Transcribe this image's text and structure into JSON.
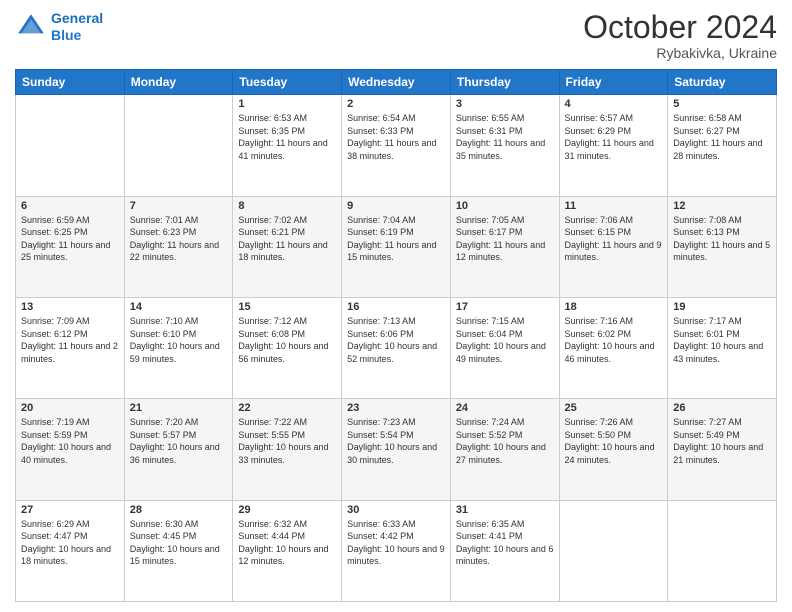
{
  "header": {
    "logo_line1": "General",
    "logo_line2": "Blue",
    "month": "October 2024",
    "location": "Rybakivka, Ukraine"
  },
  "weekdays": [
    "Sunday",
    "Monday",
    "Tuesday",
    "Wednesday",
    "Thursday",
    "Friday",
    "Saturday"
  ],
  "weeks": [
    [
      {
        "day": "",
        "content": ""
      },
      {
        "day": "",
        "content": ""
      },
      {
        "day": "1",
        "content": "Sunrise: 6:53 AM\nSunset: 6:35 PM\nDaylight: 11 hours and 41 minutes."
      },
      {
        "day": "2",
        "content": "Sunrise: 6:54 AM\nSunset: 6:33 PM\nDaylight: 11 hours and 38 minutes."
      },
      {
        "day": "3",
        "content": "Sunrise: 6:55 AM\nSunset: 6:31 PM\nDaylight: 11 hours and 35 minutes."
      },
      {
        "day": "4",
        "content": "Sunrise: 6:57 AM\nSunset: 6:29 PM\nDaylight: 11 hours and 31 minutes."
      },
      {
        "day": "5",
        "content": "Sunrise: 6:58 AM\nSunset: 6:27 PM\nDaylight: 11 hours and 28 minutes."
      }
    ],
    [
      {
        "day": "6",
        "content": "Sunrise: 6:59 AM\nSunset: 6:25 PM\nDaylight: 11 hours and 25 minutes."
      },
      {
        "day": "7",
        "content": "Sunrise: 7:01 AM\nSunset: 6:23 PM\nDaylight: 11 hours and 22 minutes."
      },
      {
        "day": "8",
        "content": "Sunrise: 7:02 AM\nSunset: 6:21 PM\nDaylight: 11 hours and 18 minutes."
      },
      {
        "day": "9",
        "content": "Sunrise: 7:04 AM\nSunset: 6:19 PM\nDaylight: 11 hours and 15 minutes."
      },
      {
        "day": "10",
        "content": "Sunrise: 7:05 AM\nSunset: 6:17 PM\nDaylight: 11 hours and 12 minutes."
      },
      {
        "day": "11",
        "content": "Sunrise: 7:06 AM\nSunset: 6:15 PM\nDaylight: 11 hours and 9 minutes."
      },
      {
        "day": "12",
        "content": "Sunrise: 7:08 AM\nSunset: 6:13 PM\nDaylight: 11 hours and 5 minutes."
      }
    ],
    [
      {
        "day": "13",
        "content": "Sunrise: 7:09 AM\nSunset: 6:12 PM\nDaylight: 11 hours and 2 minutes."
      },
      {
        "day": "14",
        "content": "Sunrise: 7:10 AM\nSunset: 6:10 PM\nDaylight: 10 hours and 59 minutes."
      },
      {
        "day": "15",
        "content": "Sunrise: 7:12 AM\nSunset: 6:08 PM\nDaylight: 10 hours and 56 minutes."
      },
      {
        "day": "16",
        "content": "Sunrise: 7:13 AM\nSunset: 6:06 PM\nDaylight: 10 hours and 52 minutes."
      },
      {
        "day": "17",
        "content": "Sunrise: 7:15 AM\nSunset: 6:04 PM\nDaylight: 10 hours and 49 minutes."
      },
      {
        "day": "18",
        "content": "Sunrise: 7:16 AM\nSunset: 6:02 PM\nDaylight: 10 hours and 46 minutes."
      },
      {
        "day": "19",
        "content": "Sunrise: 7:17 AM\nSunset: 6:01 PM\nDaylight: 10 hours and 43 minutes."
      }
    ],
    [
      {
        "day": "20",
        "content": "Sunrise: 7:19 AM\nSunset: 5:59 PM\nDaylight: 10 hours and 40 minutes."
      },
      {
        "day": "21",
        "content": "Sunrise: 7:20 AM\nSunset: 5:57 PM\nDaylight: 10 hours and 36 minutes."
      },
      {
        "day": "22",
        "content": "Sunrise: 7:22 AM\nSunset: 5:55 PM\nDaylight: 10 hours and 33 minutes."
      },
      {
        "day": "23",
        "content": "Sunrise: 7:23 AM\nSunset: 5:54 PM\nDaylight: 10 hours and 30 minutes."
      },
      {
        "day": "24",
        "content": "Sunrise: 7:24 AM\nSunset: 5:52 PM\nDaylight: 10 hours and 27 minutes."
      },
      {
        "day": "25",
        "content": "Sunrise: 7:26 AM\nSunset: 5:50 PM\nDaylight: 10 hours and 24 minutes."
      },
      {
        "day": "26",
        "content": "Sunrise: 7:27 AM\nSunset: 5:49 PM\nDaylight: 10 hours and 21 minutes."
      }
    ],
    [
      {
        "day": "27",
        "content": "Sunrise: 6:29 AM\nSunset: 4:47 PM\nDaylight: 10 hours and 18 minutes."
      },
      {
        "day": "28",
        "content": "Sunrise: 6:30 AM\nSunset: 4:45 PM\nDaylight: 10 hours and 15 minutes."
      },
      {
        "day": "29",
        "content": "Sunrise: 6:32 AM\nSunset: 4:44 PM\nDaylight: 10 hours and 12 minutes."
      },
      {
        "day": "30",
        "content": "Sunrise: 6:33 AM\nSunset: 4:42 PM\nDaylight: 10 hours and 9 minutes."
      },
      {
        "day": "31",
        "content": "Sunrise: 6:35 AM\nSunset: 4:41 PM\nDaylight: 10 hours and 6 minutes."
      },
      {
        "day": "",
        "content": ""
      },
      {
        "day": "",
        "content": ""
      }
    ]
  ]
}
